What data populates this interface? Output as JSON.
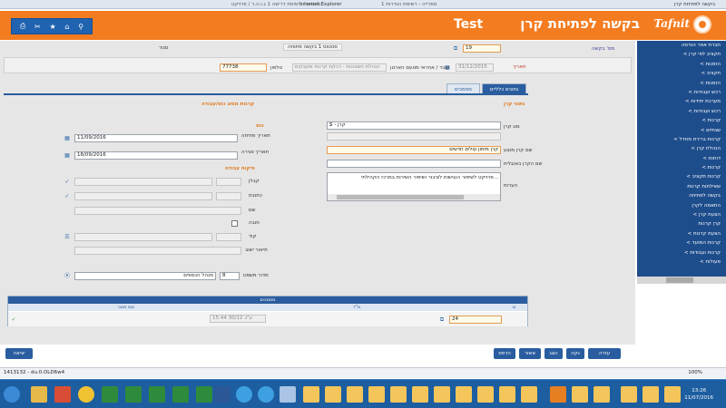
{
  "titlebar": {
    "title": "Internet Explorer",
    "left_text": "סטטוס - רשימת דרישה 1 ג.ו.ה.ר / פרויקט...",
    "middle_text": "ספרייה - רשימת הגדרות 1",
    "tab": "בקשה לפתיחת קרן"
  },
  "header": {
    "title_latin": "Test",
    "title_heb": "בקשה לפתיחת קרן",
    "logo": "Tafnit",
    "toolbar_icons": [
      "print-icon",
      "tools-icon",
      "star-icon",
      "home-icon",
      "search-icon"
    ]
  },
  "sidebar": {
    "items": [
      "חברת אפר הנדסה",
      "< תקציב לפי קרן",
      "< הזמנות",
      "< תקציב",
      "< הזמנות",
      "< רכש ועבודות",
      "< מערכת יחידות",
      "< רכש ועבודות",
      "< קרנות",
      "< שנתיים",
      "< קרנות ברירת מחדל",
      "< הנהלת קרן",
      "< דוחות",
      "< קרנות",
      "< קרנות תקציב",
      "שאילתות קרנות",
      "בקשה לפתיחה",
      "התאמה לקרן",
      "< הצעת קרן",
      "קרן קרנות",
      "< הצעת קרנות",
      "< קרנות המועד",
      "< קרנות ועבודות",
      "< פעולות"
    ]
  },
  "form": {
    "request_num_label": "מס' בקשה",
    "request_num": "19",
    "status_label": "סטטוס 1 בקשה פתוחה",
    "status_extra": "סגור",
    "date_label": "תאריך",
    "date_value": "31/12/2015",
    "employee_label": "עובד / אחראי מטעם הארגון",
    "employee_value": "הנהלת חשבונות - רכז/ת קרנות ומענקים",
    "code_label": "טלפון",
    "code_value": "77738",
    "fund_label": "נתוני קרן",
    "fund_type_label": "סוג קרן",
    "fund_type_value": "5 - קרן",
    "fund_name_label": "שם קרן מוצע",
    "fund_name_value": "קרן מימון עולים חדשים",
    "fund_name_en_label": "שם הקרן באנגלית",
    "desc_label": "הערות",
    "desc_value": "פרויקט לשיפור הנגישות לציבור ושיפור השירות במרכז הקהילתי...",
    "section_right": "קרנות מסוג כוס/עבודה",
    "period_label": "כוס",
    "start_label": "תאריך פתיחה",
    "start_value": "11/09/2016",
    "end_label": "תאריך סגירה",
    "end_value": "18/09/2016",
    "project_label": "פיקוח עבודה",
    "field_label_1": "קבלן",
    "field_label_2": "כתובת",
    "field_label_3": "שם",
    "check_label": "חובה",
    "field_label_4": "קוד",
    "field_label_5": "תיאור ישוב",
    "unit_label": "מדור משפט",
    "unit_num": "8",
    "unit_value": "מנהל הכספים"
  },
  "tabs": [
    {
      "label": "נתונים כלליים",
      "active": true
    },
    {
      "label": "מסמכים",
      "active": false
    }
  ],
  "grid": {
    "header": "מסמכים",
    "col_num": "ש",
    "col_id": "מ\"ד",
    "col_date": "שם מוצר",
    "row_id": "24",
    "row_date": "15:44 30/12 ע\"כ",
    "row_check": "✓"
  },
  "buttons": {
    "exit": "יציאה",
    "help": "עזרה",
    "clear": "נקה",
    "display": "הצג",
    "approve": "אשור",
    "print": "הדפס"
  },
  "status": {
    "left": "1413132 - du.0.OLD6w4",
    "zoom": "100%"
  },
  "taskbar": {
    "time": "13:26",
    "date": "11/07/2016"
  }
}
